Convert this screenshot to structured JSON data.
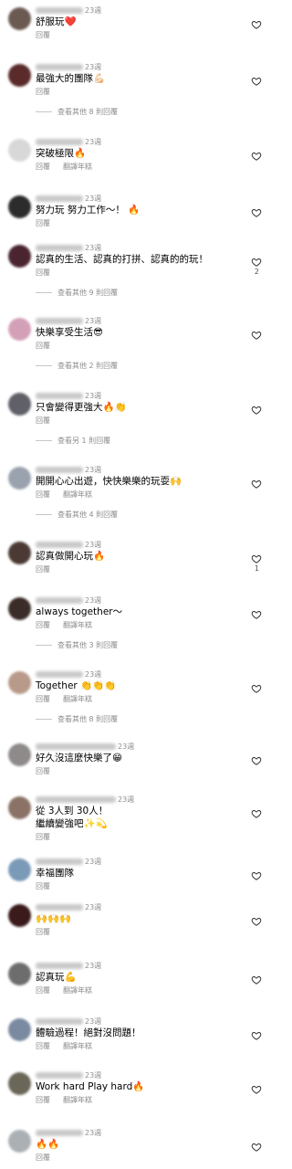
{
  "labels": {
    "reply": "回覆",
    "translate": "翻譯年糕"
  },
  "comments": [
    {
      "time": "23週",
      "text": "舒服玩❤️",
      "translate": false,
      "more": "",
      "likes": ""
    },
    {
      "time": "23週",
      "text": "最強大的團隊💪🏻",
      "translate": false,
      "more": "查看其他 8 則回覆",
      "likes": ""
    },
    {
      "time": "23週",
      "text": "突破極限🔥",
      "translate": true,
      "more": "",
      "likes": ""
    },
    {
      "time": "23週",
      "text": "努力玩 努力工作～！ 🔥",
      "translate": false,
      "more": "",
      "likes": ""
    },
    {
      "time": "23週",
      "text": "認真的生活、認真的打拼、認真的的玩！",
      "translate": false,
      "more": "查看其他 9 則回覆",
      "likes": "2"
    },
    {
      "time": "23週",
      "text": "快樂享受生活😎",
      "translate": false,
      "more": "查看其他 2 則回覆",
      "likes": ""
    },
    {
      "time": "23週",
      "text": "只會變得更強大🔥👏",
      "translate": false,
      "more": "查看另 1 則回覆",
      "likes": ""
    },
    {
      "time": "23週",
      "text": "開開心心出遊，快快樂樂的玩耍🙌",
      "translate": true,
      "more": "查看其他 4 則回覆",
      "likes": ""
    },
    {
      "time": "23週",
      "text": "認真做開心玩🔥",
      "translate": false,
      "more": "",
      "likes": "1"
    },
    {
      "time": "23週",
      "text": "always together～",
      "translate": true,
      "more": "查看其他 3 則回覆",
      "likes": ""
    },
    {
      "time": "23週",
      "text": "Together 👏👏👏",
      "translate": true,
      "more": "查看其他 8 則回覆",
      "likes": ""
    },
    {
      "time": "23週",
      "text": "好久沒這麼快樂了😁",
      "translate": false,
      "more": "",
      "likes": ""
    },
    {
      "time": "23週",
      "text": "從 3人到 30人！\n繼續變強吧✨💫",
      "translate": false,
      "more": "",
      "likes": ""
    },
    {
      "time": "23週",
      "text": "幸福團隊",
      "translate": false,
      "more": "",
      "likes": ""
    },
    {
      "time": "23週",
      "text": "🙌🙌🙌",
      "translate": false,
      "more": "",
      "likes": ""
    },
    {
      "time": "23週",
      "text": "認真玩💪",
      "translate": true,
      "more": "",
      "likes": ""
    },
    {
      "time": "23週",
      "text": "體驗過程！絕對沒問題！",
      "translate": true,
      "more": "",
      "likes": ""
    },
    {
      "time": "23週",
      "text": "Work hard Play hard🔥",
      "translate": true,
      "more": "",
      "likes": ""
    },
    {
      "time": "23週",
      "text": "🔥🔥",
      "translate": false,
      "more": "",
      "likes": ""
    }
  ]
}
